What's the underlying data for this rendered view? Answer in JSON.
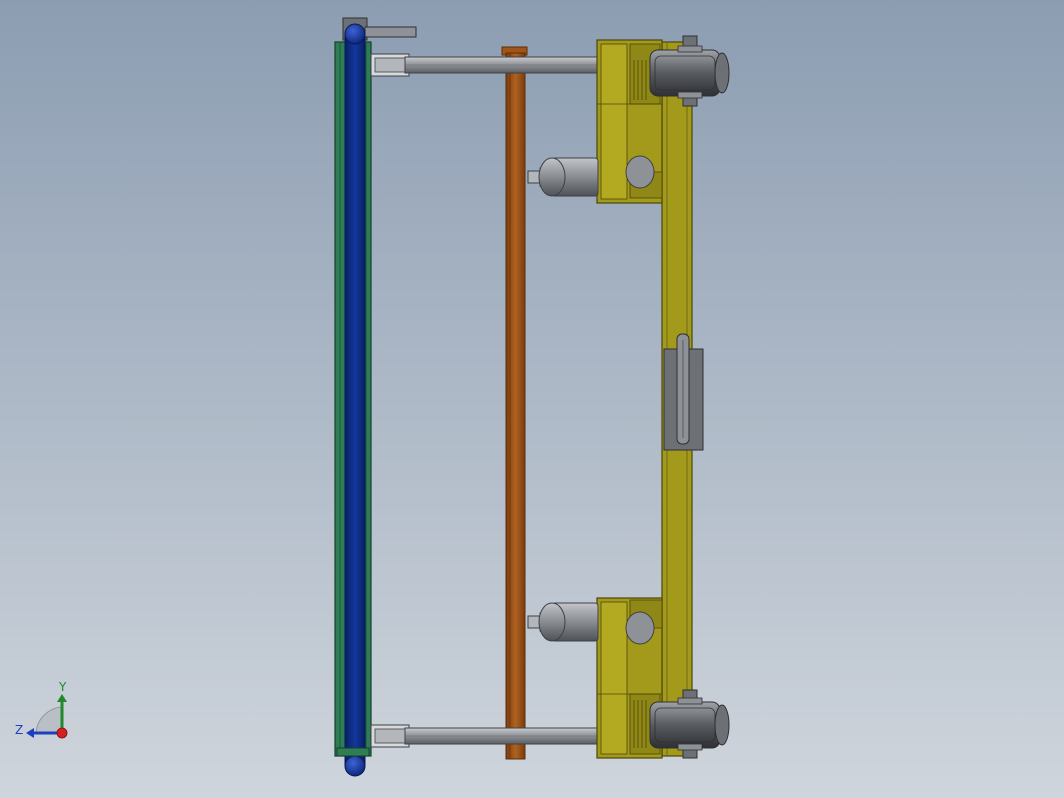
{
  "viewport": {
    "background_top": "#8c9db2",
    "background_bottom": "#cfd5dc"
  },
  "model": {
    "colors": {
      "panel_green": "#2f7d55",
      "panel_green_dark": "#1f5a3c",
      "panel_blue": "#0d2e86",
      "panel_blue_dark": "#061a55",
      "frame_olive": "#a39a1c",
      "frame_olive_dark": "#5e5a0e",
      "shaft_brown": "#a0561b",
      "shaft_brown_dark": "#5c2d08",
      "steel_gray": "#9a9da2",
      "steel_dark": "#45484c",
      "wheel_dark": "#4a4d52"
    }
  },
  "triad": {
    "y_label": "Y",
    "z_label": "Z",
    "x_color": "#d32222",
    "y_color": "#1f8a2c",
    "z_color": "#1d3fbf"
  }
}
